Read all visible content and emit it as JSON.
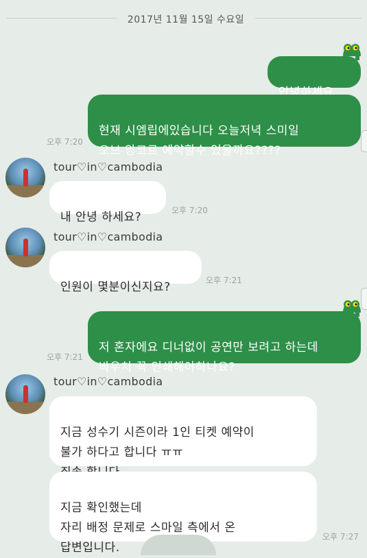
{
  "date_divider": "2017년 11월 15일 수요일",
  "messages": [
    {
      "text": "안녕하세요",
      "time": ""
    },
    {
      "text": "현재 시엠립에있습니다 오늘저녁 스미일\n오브 앙코르 예약할수 있을까요????",
      "time": "오후 7:20"
    },
    {
      "sender": "tour♡in♡cambodia",
      "text": "내 안녕 하세요?",
      "time": "오후 7:20"
    },
    {
      "sender": "tour♡in♡cambodia",
      "text": "인원이 몇분이신지요?",
      "time": "오후 7:21"
    },
    {
      "text": "저 혼자에요 디너없이 공연만 보려고 하는데\n바우처 꼭 인쇄해야하나요?",
      "time": "오후 7:21"
    },
    {
      "sender": "tour♡in♡cambodia",
      "text": "지금 성수기 시즌이라 1인 티켓 예약이\n불가 하다고 합니다 ㅠㅠ\n죄송 합니다.",
      "time": ""
    },
    {
      "text": "지금 확인했는데\n자리 배정 문제로 스마일 측에서 온\n답변입니다.",
      "time": "오후 7:27"
    }
  ],
  "colors": {
    "outgoing": "#2e8f48",
    "incoming": "#ffffff",
    "background": "#e6ece7"
  },
  "icons": {
    "sticker": "crocodile-icon",
    "avatar": "profile-photo"
  }
}
